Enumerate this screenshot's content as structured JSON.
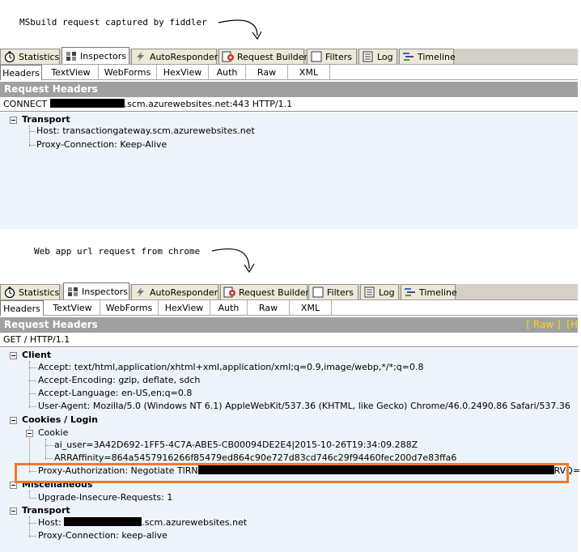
{
  "captions": {
    "top": "MSbuild request captured by fiddler",
    "bottom": "Web app url request from chrome"
  },
  "main_tabs": [
    {
      "label": "Statistics",
      "icon": "stopwatch-icon"
    },
    {
      "label": "Inspectors",
      "icon": "inspectors-icon",
      "active": true
    },
    {
      "label": "AutoResponder",
      "icon": "lightning-icon"
    },
    {
      "label": "Request Builder",
      "icon": "request-builder-icon"
    },
    {
      "label": "Filters",
      "icon": "checkbox-icon"
    },
    {
      "label": "Log",
      "icon": "log-icon"
    },
    {
      "label": "Timeline",
      "icon": "timeline-icon"
    }
  ],
  "sub_tabs": [
    "Headers",
    "TextView",
    "WebForms",
    "HexView",
    "Auth",
    "Raw",
    "XML"
  ],
  "panel1": {
    "section_title": "Request Headers",
    "request_line_prefix": "CONNECT ",
    "request_line_suffix": ".scm.azurewebsites.net:443 HTTP/1.1",
    "groups": [
      {
        "name": "Transport",
        "items": [
          "Host: transactiongateway.scm.azurewebsites.net",
          "Proxy-Connection: Keep-Alive"
        ]
      }
    ]
  },
  "panel2": {
    "section_title": "Request Headers",
    "raw_link": "[ Raw ]",
    "h_link": "[H",
    "request_line": "GET / HTTP/1.1",
    "client": {
      "name": "Client",
      "items": [
        "Accept: text/html,application/xhtml+xml,application/xml;q=0.9,image/webp,*/*;q=0.8",
        "Accept-Encoding: gzip, deflate, sdch",
        "Accept-Language: en-US,en;q=0.8",
        "User-Agent: Mozilla/5.0 (Windows NT 6.1) AppleWebKit/537.36 (KHTML, like Gecko) Chrome/46.0.2490.86 Safari/537.36"
      ]
    },
    "cookies": {
      "name": "Cookies / Login",
      "cookie_label": "Cookie",
      "cookie_items": [
        "ai_user=3A42D692-1FF5-4C7A-ABE5-CB00094DE2E4|2015-10-26T19:34:09.288Z",
        "ARRAffinity=864a5457916266f85479ed864c90e727d83cd746c29f94460fec200d7e83ffa6"
      ],
      "proxy_auth_prefix": "Proxy-Authorization: Negotiate TlRN",
      "proxy_auth_suffix": "RVQ="
    },
    "misc": {
      "name": "Miscellaneous",
      "items": [
        "Upgrade-Insecure-Requests: 1"
      ]
    },
    "transport": {
      "name": "Transport",
      "host_prefix": "Host: ",
      "host_suffix": ".scm.azurewebsites.net",
      "items": [
        "Proxy-Connection: keep-alive"
      ]
    }
  },
  "colors": {
    "highlight": "#f07a2a",
    "section_bar": "#a0a0a0",
    "tree_bg": "#eef4fb",
    "raw_link": "#ffd700"
  }
}
